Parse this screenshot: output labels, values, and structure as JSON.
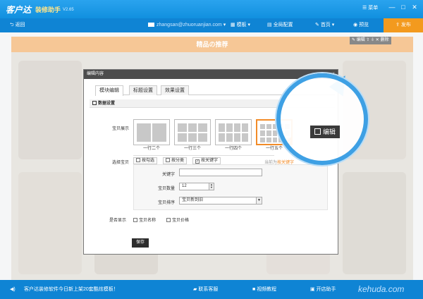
{
  "titlebar": {
    "app_name": "客户达",
    "app_subtitle": "装修助手",
    "version": "V2.65",
    "menu_label": "菜单",
    "minimize": "—",
    "maximize": "□",
    "close": "✕"
  },
  "toolbar": {
    "back_label": "返回",
    "account_email": "zhangsan@zhuoruanjian.com",
    "template_label": "模板",
    "global_config_label": "全局配置",
    "home_label": "首页",
    "preview_label": "预览",
    "publish_label": "发布",
    "chevron": "▾"
  },
  "canvas": {
    "banner_title": "精品の推荐",
    "edit_tools": {
      "edit": "编辑",
      "up": "⇧",
      "down": "⇩",
      "delete": "删除"
    }
  },
  "modal": {
    "title": "编辑内容",
    "close": "×",
    "tabs": [
      "模块编辑",
      "标题设置",
      "效果设置"
    ],
    "active_tab": 0,
    "section_title": "数据设置",
    "display_label": "宝贝展示",
    "layout_options": [
      {
        "caption": "一行二个",
        "cols": 2,
        "rows": 1,
        "selected": false
      },
      {
        "caption": "一行三个",
        "cols": 3,
        "rows": 2,
        "selected": false
      },
      {
        "caption": "一行四个",
        "cols": 4,
        "rows": 2,
        "selected": false
      },
      {
        "caption": "一行五个",
        "cols": 5,
        "rows": 3,
        "selected": true
      }
    ],
    "select_label": "选择宝贝",
    "select_modes": [
      "按勾选",
      "按分类",
      "按关键字"
    ],
    "checked_mode": 2,
    "current_mode_prefix": "当前为",
    "current_mode_value": "按关键字",
    "keyword_label": "关键字",
    "keyword_value": "",
    "quantity_label": "宝贝数量",
    "quantity_value": "12",
    "sort_label": "宝贝排序",
    "sort_value": "宝贝新到旧",
    "show_label": "是否显示",
    "show_options": [
      "宝贝名称",
      "宝贝价格"
    ],
    "save_label": "保存"
  },
  "magnifier": {
    "edit_label": "编辑"
  },
  "statusbar": {
    "announcement": "客户达装修软件今日新上架20套酷炫模板！",
    "contact_label": "联系客服",
    "video_label": "视频教程",
    "shop_helper_label": "开店助手",
    "watermark": "kehuda.com"
  },
  "colors": {
    "brand_blue": "#1190df",
    "toolbar_blue": "#0f84d4",
    "publish_orange": "#f39a1e",
    "banner_orange": "#ef9f4a",
    "selected_border": "#f28c28",
    "current_mode_text": "#f28c28"
  }
}
